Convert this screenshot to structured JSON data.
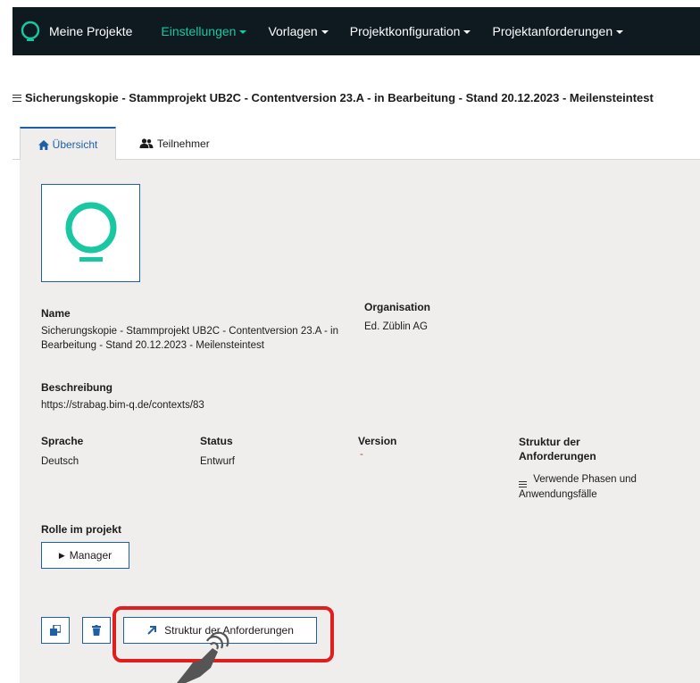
{
  "navbar": {
    "brand": "Meine Projekte",
    "items": [
      {
        "label": "Einstellungen",
        "active": true
      },
      {
        "label": "Vorlagen",
        "active": false
      },
      {
        "label": "Projektkonfiguration",
        "active": false
      },
      {
        "label": "Projektanforderungen",
        "active": false
      }
    ]
  },
  "page": {
    "title": "Sicherungskopie - Stammprojekt UB2C - Contentversion 23.A - in Bearbeitung - Stand 20.12.2023 - Meilensteintest"
  },
  "tabs": [
    {
      "label": "Übersicht",
      "icon": "home-icon"
    },
    {
      "label": "Teilnehmer",
      "icon": "users-icon"
    }
  ],
  "overview": {
    "name_label": "Name",
    "name_value": "Sicherungskopie - Stammprojekt UB2C - Contentversion 23.A - in Bearbeitung - Stand 20.12.2023 - Meilensteintest",
    "organisation_label": "Organisation",
    "organisation_value": "Ed. Züblin AG",
    "description_label": "Beschreibung",
    "description_value": "https://strabag.bim-q.de/contexts/83",
    "language_label": "Sprache",
    "language_value": "Deutsch",
    "status_label": "Status",
    "status_value": "Entwurf",
    "version_label": "Version",
    "version_value": "-",
    "structure_label": "Struktur der Anforderungen",
    "structure_value": "Verwende Phasen und Anwendungsfälle",
    "role_label": "Rolle im projekt",
    "role_value": "Manager"
  },
  "actions": {
    "structure_button": "Struktur der Anforderungen"
  },
  "colors": {
    "navbar_bg": "#0f1a20",
    "accent": "#19c7a3",
    "primary": "#1f5fa6",
    "panel_bg": "#efeeec",
    "highlight": "#e01e1e"
  }
}
